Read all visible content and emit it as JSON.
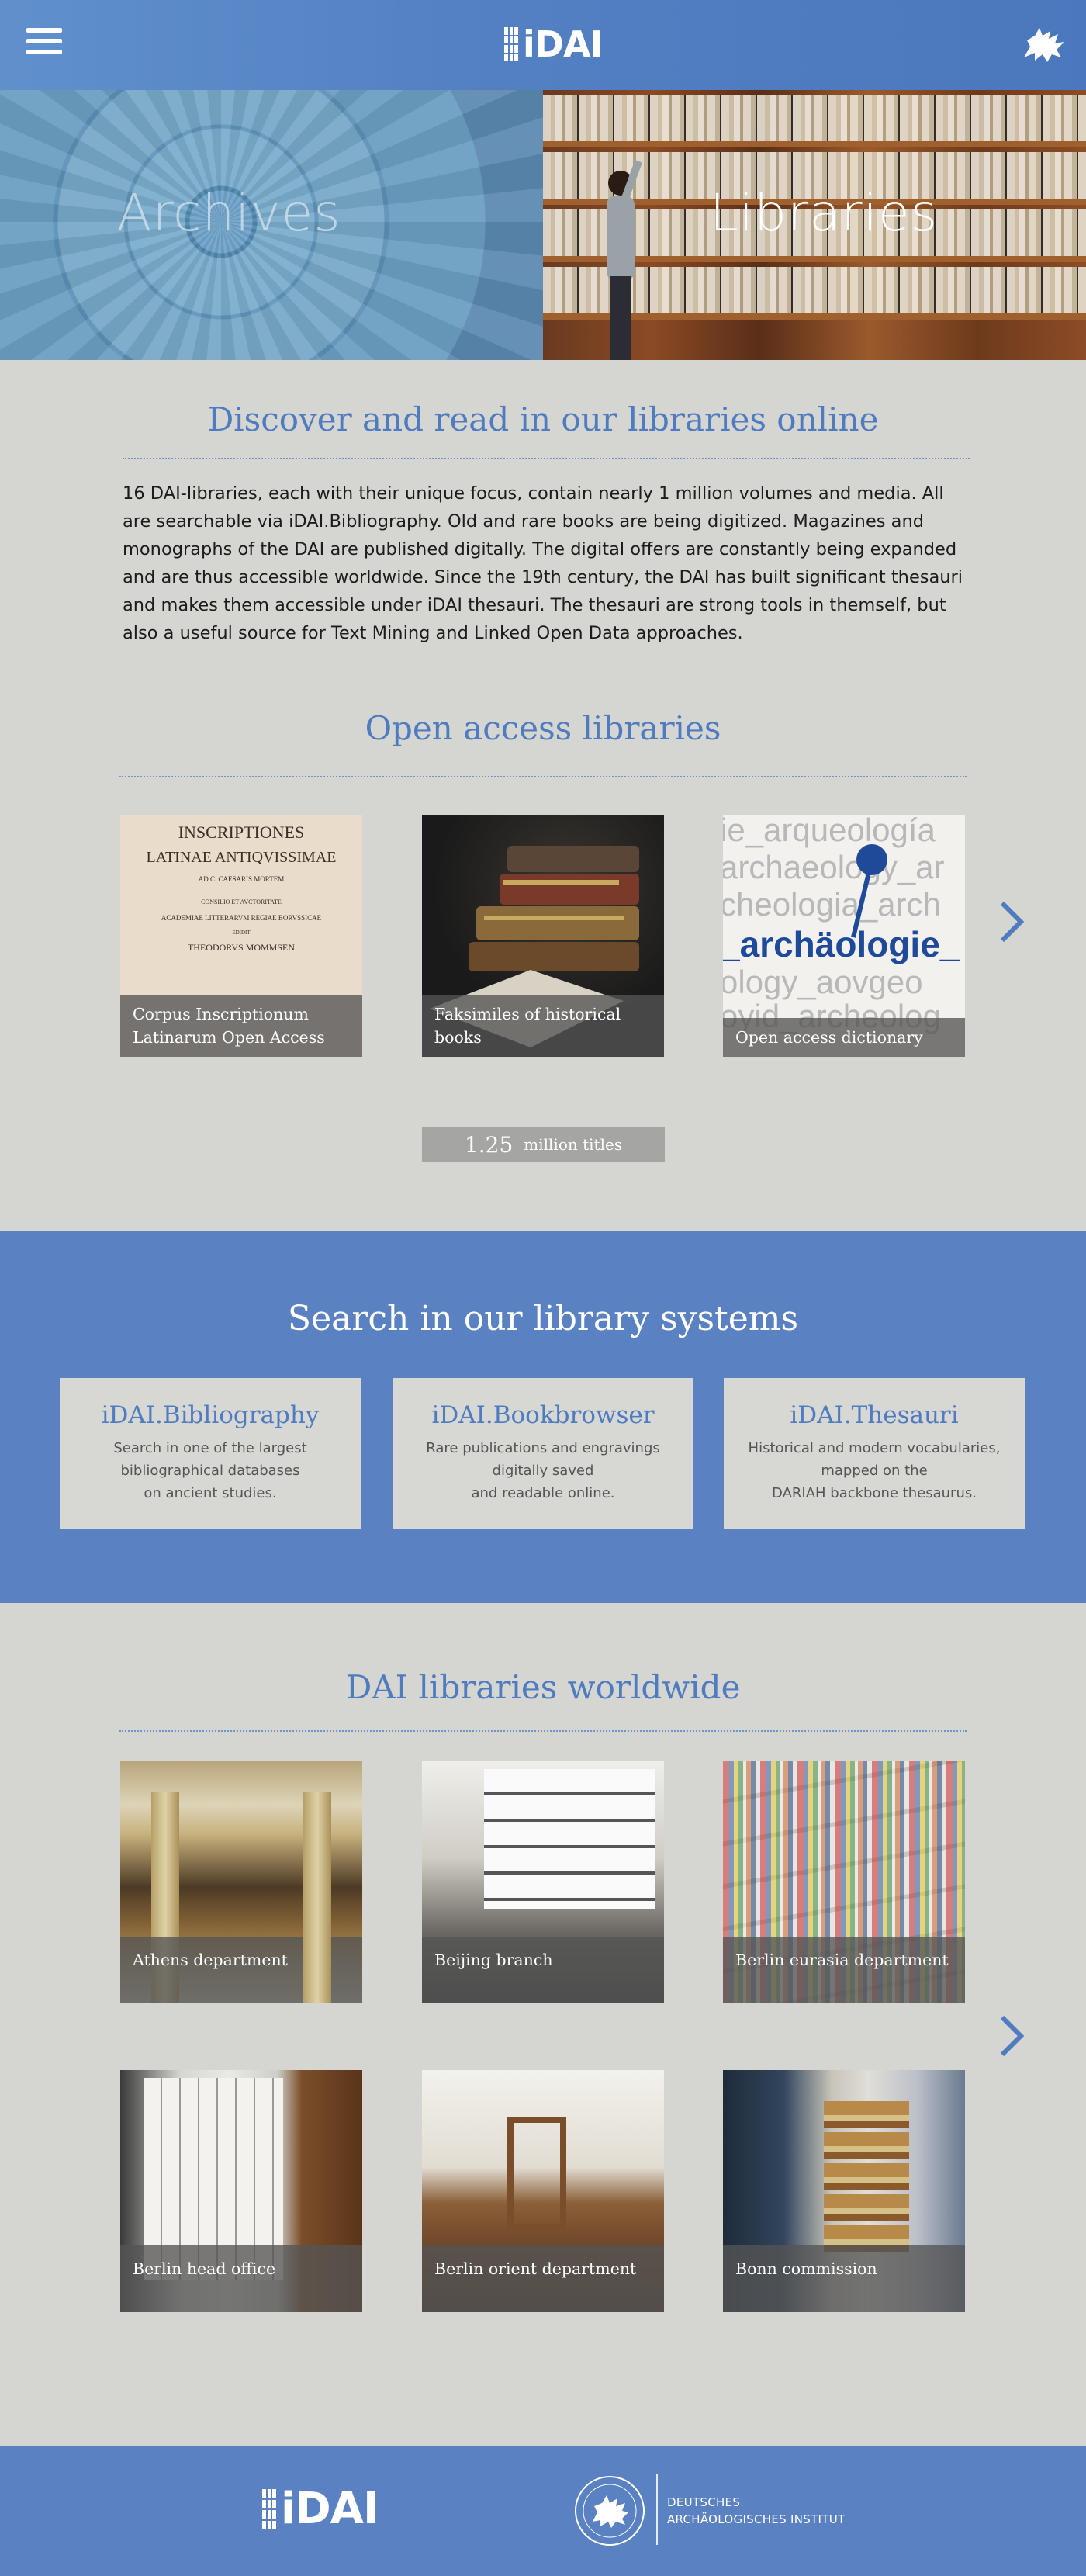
{
  "header": {
    "logo_text": "iDAI"
  },
  "hero": {
    "archives_label": "Archives",
    "libraries_label": "Libraries"
  },
  "intro": {
    "title": "Discover and read in our libraries online",
    "text": "16 DAI-libraries, each with their unique focus, contain nearly 1 million volumes and media. All are searchable via iDAI.Bibliography. Old and rare books are being digitized. Magazines and monographs of the DAI are published digitally. The digital offers are constantly being expanded and are thus accessible worldwide. Since the 19th century, the DAI has built significant thesauri and makes them accessible under iDAI thesauri. The thesauri are strong tools in themself, but also a useful source for Text Mining and Linked Open Data approaches."
  },
  "open_access": {
    "title": "Open access libraries",
    "cards": [
      {
        "caption": "Corpus Inscriptionum Latinarum Open Access",
        "image_text": [
          "INSCRIPTIONES",
          "LATINAE ANTIQVISSIMAE",
          "AD C. CAESARIS MORTEM",
          "CONSILIO ET AVCTORITATE",
          "ACADEMIAE LITTERARVM REGIAE BORVSSICAE",
          "EDIDIT",
          "THEODORVS MOMMSEN"
        ]
      },
      {
        "caption": "Faksimiles of historical books"
      },
      {
        "caption": "Open access dictionary",
        "image_words": [
          "ie_arqueología",
          "archaeology_ar",
          "cheologia_arch",
          "_archäologie_",
          "ology_aovgeo",
          "oyid_archeolog"
        ]
      }
    ],
    "counter_number": "1.25",
    "counter_label": "million titles"
  },
  "systems": {
    "title": "Search in our library systems",
    "items": [
      {
        "name": "iDAI.Bibliography",
        "desc": "Search in one of the largest\nbibliographical databases\non ancient studies."
      },
      {
        "name": "iDAI.Bookbrowser",
        "desc": "Rare publications and engravings\ndigitally saved\nand readable online."
      },
      {
        "name": "iDAI.Thesauri",
        "desc": "Historical and modern vocabularies,\nmapped on the\nDARIAH backbone thesaurus."
      }
    ]
  },
  "worldwide": {
    "title": "DAI libraries worldwide",
    "libraries": [
      {
        "name": "Athens department"
      },
      {
        "name": "Beijing branch"
      },
      {
        "name": "Berlin eurasia department"
      },
      {
        "name": "Berlin head office"
      },
      {
        "name": "Berlin orient department"
      },
      {
        "name": "Bonn commission"
      }
    ]
  },
  "footer": {
    "logo_text": "iDAI",
    "institute_line1": "DEUTSCHES",
    "institute_line2": "ARCHÄOLOGISCHES INSTITUT"
  },
  "colors": {
    "brand_blue": "#4f7cc0",
    "band_blue": "#5a81c2",
    "page_bg": "#d5d5d1"
  },
  "icons": [
    "menu-icon",
    "griffin-icon",
    "chevron-right-icon",
    "seal-icon"
  ]
}
